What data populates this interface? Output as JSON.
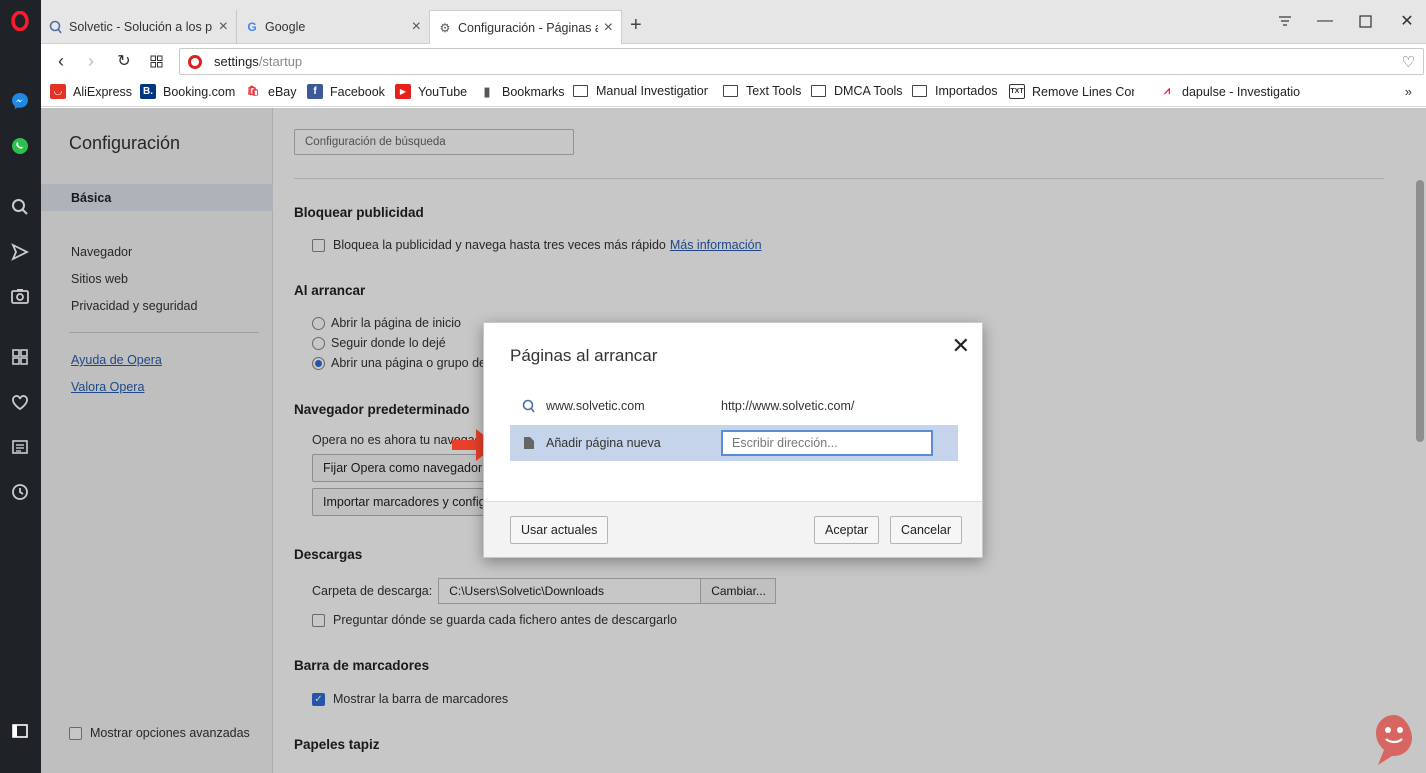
{
  "tabs": [
    {
      "title": "Solvetic - Solución a los pr",
      "icon": "solvetic-icon",
      "active": false
    },
    {
      "title": "Google",
      "icon": "google-icon",
      "active": false
    },
    {
      "title": "Configuración - Páginas al",
      "icon": "gear-icon",
      "active": true
    }
  ],
  "address": {
    "host": "settings",
    "path": "/startup"
  },
  "bookmarks": [
    {
      "label": "AliExpress",
      "icon": "aliexpress-icon"
    },
    {
      "label": "Booking.com",
      "icon": "booking-icon"
    },
    {
      "label": "eBay",
      "icon": "ebay-icon"
    },
    {
      "label": "Facebook",
      "icon": "facebook-icon"
    },
    {
      "label": "YouTube",
      "icon": "youtube-icon"
    },
    {
      "label": "Bookmarks",
      "icon": "file-icon"
    },
    {
      "label": "Manual Investigation",
      "icon": "folder-icon"
    },
    {
      "label": "Text Tools",
      "icon": "folder-icon"
    },
    {
      "label": "DMCA Tools",
      "icon": "folder-icon"
    },
    {
      "label": "Importados",
      "icon": "folder-icon"
    },
    {
      "label": "Remove Lines Contai",
      "icon": "txt-icon"
    },
    {
      "label": "dapulse - Investigatio",
      "icon": "dapulse-icon"
    }
  ],
  "settings_nav": {
    "title": "Configuración",
    "active": "Básica",
    "items": [
      "Navegador",
      "Sitios web",
      "Privacidad y seguridad"
    ],
    "links": [
      "Ayuda de Opera",
      "Valora Opera"
    ],
    "advanced": "Mostrar opciones avanzadas"
  },
  "content": {
    "search_placeholder": "Configuración de búsqueda",
    "adblock": {
      "title": "Bloquear publicidad",
      "checkbox": "Bloquea la publicidad y navega hasta tres veces más rápido",
      "link": "Más información"
    },
    "startup": {
      "title": "Al arrancar",
      "options": [
        "Abrir la página de inicio",
        "Seguir donde lo dejé",
        "Abrir una página o grupo de"
      ]
    },
    "default_browser": {
      "title": "Navegador predeterminado",
      "text": "Opera no es ahora tu navegador",
      "set_button": "Fijar Opera como navegador p",
      "import_button": "Importar marcadores y configu"
    },
    "downloads": {
      "title": "Descargas",
      "folder_label": "Carpeta de descarga:",
      "folder_value": "C:\\Users\\Solvetic\\Downloads",
      "change_button": "Cambiar...",
      "ask_checkbox": "Preguntar dónde se guarda cada fichero antes de descargarlo"
    },
    "bookmarks_bar": {
      "title": "Barra de marcadores",
      "checkbox": "Mostrar la barra de marcadores"
    },
    "wallpapers": {
      "title": "Papeles tapiz"
    }
  },
  "dialog": {
    "title": "Páginas al arrancar",
    "pages": [
      {
        "name": "www.solvetic.com",
        "url": "http://www.solvetic.com/"
      }
    ],
    "add_label": "Añadir página nueva",
    "input_placeholder": "Escribir dirección...",
    "use_current": "Usar actuales",
    "accept": "Aceptar",
    "cancel": "Cancelar"
  },
  "colors": {
    "sidebar": "#1f2227",
    "accent": "#2e6fd8",
    "opera_red": "#e02020",
    "selection": "#c5d4ea"
  }
}
